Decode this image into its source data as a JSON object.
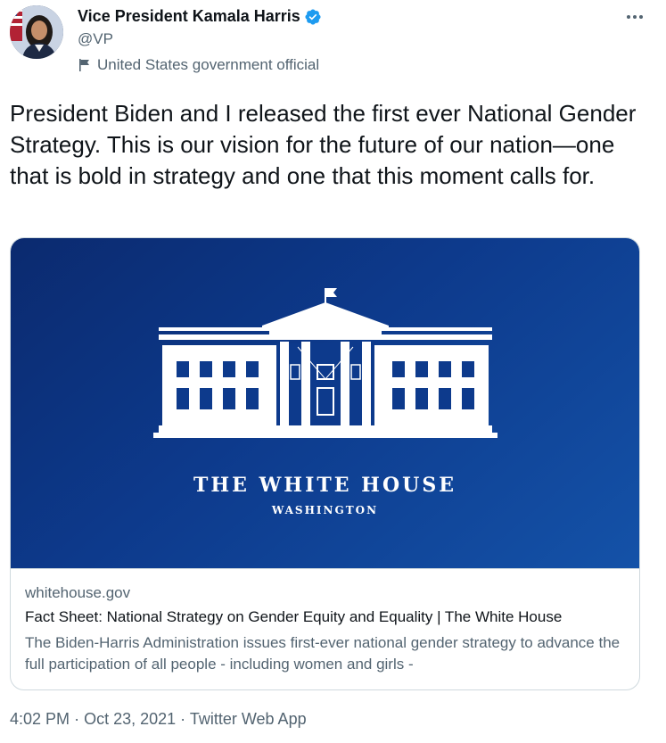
{
  "author": {
    "display_name": "Vice President Kamala Harris",
    "handle": "@VP",
    "label": "United States government official",
    "avatar_icon": "profile-photo",
    "verified_icon": "verified-badge-icon",
    "verified_color": "#1d9bf0"
  },
  "tweet": {
    "text": "President Biden and I released the first ever National Gender Strategy. This is our vision for the future of our nation—one that is bold in strategy and one that this moment calls for."
  },
  "card": {
    "image_title": "THE WHITE HOUSE",
    "image_subtitle": "WASHINGTON",
    "domain": "whitehouse.gov",
    "title": "Fact Sheet: National Strategy on Gender Equity and Equality | The White House",
    "description": "The Biden-Harris Administration issues first-ever national gender strategy to advance the full participation of all people - including women and girls -",
    "image_colors": [
      "#0b2a6f",
      "#1452a8"
    ]
  },
  "meta": {
    "time": "4:02 PM",
    "date": "Oct 23, 2021",
    "source": "Twitter Web App",
    "separator": "·"
  },
  "colors": {
    "text_primary": "#0f1419",
    "text_secondary": "#536471",
    "border": "#cfd9de"
  }
}
